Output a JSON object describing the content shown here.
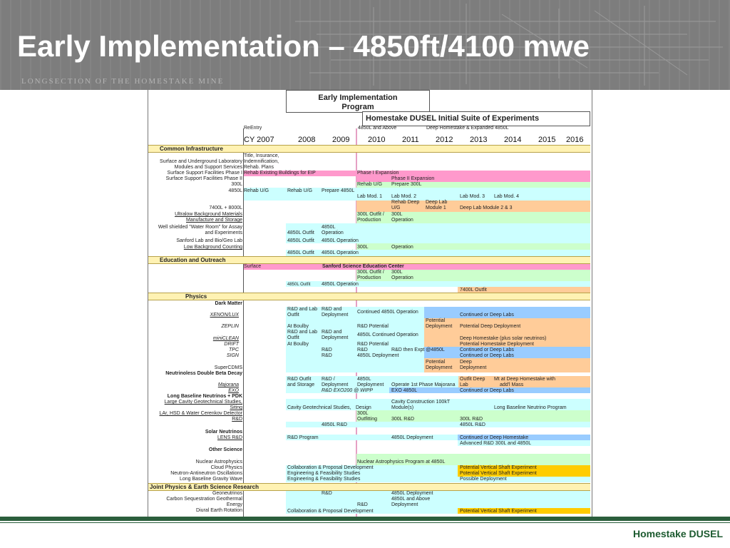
{
  "slide": {
    "title": "Early Implementation – 4850ft/4100 mwe",
    "subtitle": "LONGSECTION OF THE HOMESTAKE MINE",
    "brand": "Homestake DUSEL"
  },
  "colors": {
    "header": "#7d7d7d",
    "footer": "#2b5e3c",
    "cyan": "#ccffff",
    "green": "#ccffcc",
    "pink": "#ff99cc",
    "orange": "#ffcc99",
    "blue": "#99ccff",
    "yellow": "#ffcc00",
    "section": "#fff2b3",
    "marker": "#e6a0c4"
  },
  "table": {
    "box1_line1": "Early Implementation",
    "box1_line2": "Program",
    "box2": "Homestake DUSEL Initial Suite of Experiments",
    "reentry": "ReEntry",
    "phase_a": "4850L and Above",
    "phase_b": "Deep Homestake & Expanded 4850L",
    "years": [
      "CY 2007",
      "2008",
      "2009",
      "2010",
      "2011",
      "2012",
      "2013",
      "2014",
      "2015",
      "2016"
    ],
    "sections": {
      "common": "Common Infrastructure",
      "education": "Education and Outreach",
      "physics": "Physics",
      "joint": "Joint Physics & Earth Science Research"
    },
    "labels": {
      "sul_1": "Surface and Underground Laboratory",
      "sul_2": "Modules and Support Services",
      "ssf1": "Surface Support Facilities Phase I",
      "ssf2": "Surface Support Facilities Phase II",
      "l300": "300L",
      "l4850": "4850L",
      "l7400": "7400L + 8000L",
      "ulb_1": "Ultralow Background Materials",
      "ulb_2": "Manufacture and Storage",
      "ws_1": "Well shielded \"Water Room\" for Assay",
      "ws_2": "and Experiments",
      "sanford": "Sanford Lab and Bio/Geo Lab",
      "lbc": "Low Background Counting",
      "dark": "Dark Matter",
      "xenon": "XENON/LUX",
      "zeplin": "ZEPLIN",
      "miniclean": "miniCLEAN",
      "drift": "DRIFT",
      "tpc": "TPC",
      "sign": "SIGN",
      "supercdms": "SuperCDMS",
      "ndbd": "Neutrinoless Double Beta Decay",
      "majorana": "Majorana",
      "exo": "EXO",
      "lbn": "Long Baseline Neutrinos + PDK",
      "lcg": "Large Cavity Geotechnical Studies,",
      "siting": "Siting",
      "lar": "LAr, HSD & Water Cerenkov Detector",
      "rnd": "R&D",
      "solar": "Solar Neutrinos",
      "lens": "LENS R&D",
      "other": "Other Science",
      "nap": "Nuclear Astrophysics",
      "cloud": "Cloud Physics",
      "nao": "Neutron-Antineutron Oscillations",
      "lbgw": "Long Baseline Gravity Wave",
      "geo": "Geoneutrinos",
      "carbon": "Carbon Sequestration Geothermal",
      "energy": "Energy",
      "diurnal": "Diural Earth Rotation"
    },
    "cells": {
      "title_ins": "Title, Insurance,",
      "indemn": "Indemnification,",
      "rehab_plans": "Rehab. Plans",
      "rehab_eip": "Rehab Existing Buildings for EIP",
      "phase1_exp": "Phase I Expansion",
      "phase2_exp": "Phase II Expansion",
      "rehab_ug": "Rehab U/G",
      "prep300": "Prepare 300L",
      "prep4850": "Prepare 4850L",
      "labmod1": "Lab Mod. 1",
      "labmod2": "Lab Mod. 2",
      "labmod3": "Lab Mod. 3",
      "labmod4": "Lab Mod. 4",
      "rehab_deep": "Rehab Deep",
      "ug": "U/G",
      "deep_lab": "Deep Lab",
      "module1": "Module 1",
      "deep_lab_mod23": "Deep Lab Module 2 & 3",
      "outfit300": "300L Outfit /",
      "production": "Production",
      "l300": "300L",
      "operation": "Operation",
      "outfit4850": "4850L Outfit",
      "l4850": "4850L",
      "op4850": "4850L Operation",
      "surface": "Surface",
      "ssec": "Sanford Science Education Center",
      "outfit7400": "7400L Outfit",
      "rnd_lab": "R&D and Lab",
      "outfit": "Outfit",
      "rnd_and": "R&D and",
      "deployment": "Deployment",
      "cont_op": "Continued 4850L Operation",
      "cont_deep": "Continued or Deep Labs",
      "potential": "Potential",
      "pot_deep": "Potential Deep Deployment",
      "at_boulby": "At Boulby",
      "rnd_pot": "R&D Potential",
      "cont_op2": "4850L Continued Operation",
      "deep_homestake": "Deep Homestake (plus solar neutrinos)",
      "pot_homestake": "Potential Homestake Deployment",
      "rnd": "R&D",
      "rnd_then": "R&D then  Expt @4850L",
      "dep4850": "4850L Deployment",
      "deep": "Deep",
      "rnd_outfit": "R&D Outfit",
      "and_storage": "and Storage",
      "rnd_slash": "R&D /",
      "op_majorana": "Operate 1st Phase Majorana",
      "outfit_deep": "Outfit Deep",
      "lab": "Lab",
      "mt_deep": "Mt at Deep Homestake with",
      "addl": "add'l Mass",
      "exo200": "R&D EXO200 @ WIPP",
      "exo4850": "EXO 4850L",
      "cavity": "Cavity Construction 100kT",
      "design": "Design",
      "modules": "Module(s)",
      "cavity_geo": "Cavity Geotechnical Studies,",
      "lbnp": "Long Baseline Neutrino Program",
      "outfitting": "Outfitting",
      "rnd300": "300L R&D",
      "rnd4850": "4850L R&D",
      "rnd_program": "R&D Program",
      "cont_deep_hs": "Continued or Deep Homestake",
      "adv_rnd": "Advanced R&D 300L and 4850L",
      "nap4850": "Nuclear Astrophysics Program at 4850L",
      "collab": "Collaboration & Proposal Development",
      "pvse": "Potential Vertical Shaft Experiment",
      "eng_feas": "Engineering & Feasibility Studies",
      "possible": "Possible Deployment",
      "and_above": "4850L and Above"
    }
  }
}
